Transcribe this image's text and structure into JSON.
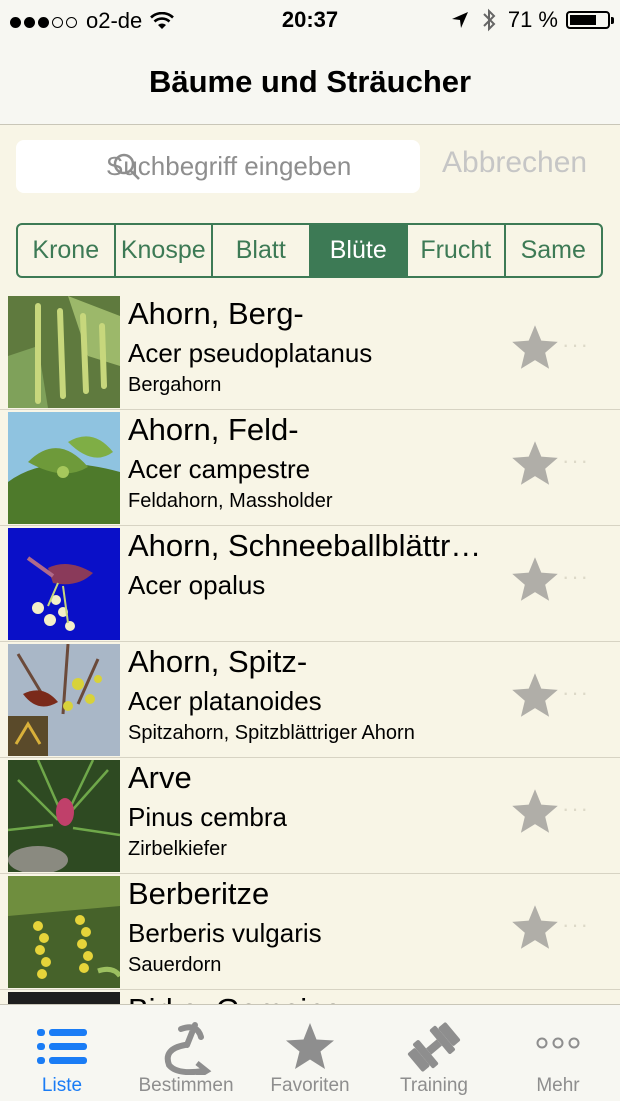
{
  "status": {
    "carrier": "o2-de",
    "time": "20:37",
    "battery": "71 %",
    "battery_level": 0.71
  },
  "nav": {
    "title": "Bäume und Sträucher"
  },
  "search": {
    "placeholder": "Suchbegriff eingeben",
    "cancel_label": "Abbrechen"
  },
  "segments": [
    {
      "label": "Krone",
      "active": false
    },
    {
      "label": "Knospe",
      "active": false
    },
    {
      "label": "Blatt",
      "active": false
    },
    {
      "label": "Blüte",
      "active": true
    },
    {
      "label": "Frucht",
      "active": false
    },
    {
      "label": "Same",
      "active": false
    }
  ],
  "list": [
    {
      "title": "Ahorn, Berg-",
      "latin": "Acer pseudoplatanus",
      "common": "Bergahorn",
      "more": "···"
    },
    {
      "title": "Ahorn, Feld-",
      "latin": "Acer campestre",
      "common": "Feldahorn, Massholder",
      "more": "···"
    },
    {
      "title": "Ahorn, Schneeballblättr…",
      "latin": "Acer opalus",
      "common": "",
      "more": "···"
    },
    {
      "title": "Ahorn, Spitz-",
      "latin": "Acer platanoides",
      "common": "Spitzahorn, Spitzblättriger Ahorn",
      "more": "···"
    },
    {
      "title": "Arve",
      "latin": "Pinus cembra",
      "common": "Zirbelkiefer",
      "more": "···"
    },
    {
      "title": "Berberitze",
      "latin": "Berberis vulgaris",
      "common": "Sauerdorn",
      "more": "···"
    },
    {
      "title": "Birke, Gemeine",
      "latin": "",
      "common": "",
      "more": ""
    }
  ],
  "tabs": [
    {
      "label": "Liste",
      "icon": "list-icon",
      "active": true
    },
    {
      "label": "Bestimmen",
      "icon": "identify-icon",
      "active": false
    },
    {
      "label": "Favoriten",
      "icon": "star-icon",
      "active": false
    },
    {
      "label": "Training",
      "icon": "dumbbell-icon",
      "active": false
    },
    {
      "label": "Mehr",
      "icon": "more-icon",
      "active": false
    }
  ],
  "colors": {
    "accent": "#3d7a55",
    "tab_active": "#1a7cf5",
    "background": "#f8f5e6"
  }
}
